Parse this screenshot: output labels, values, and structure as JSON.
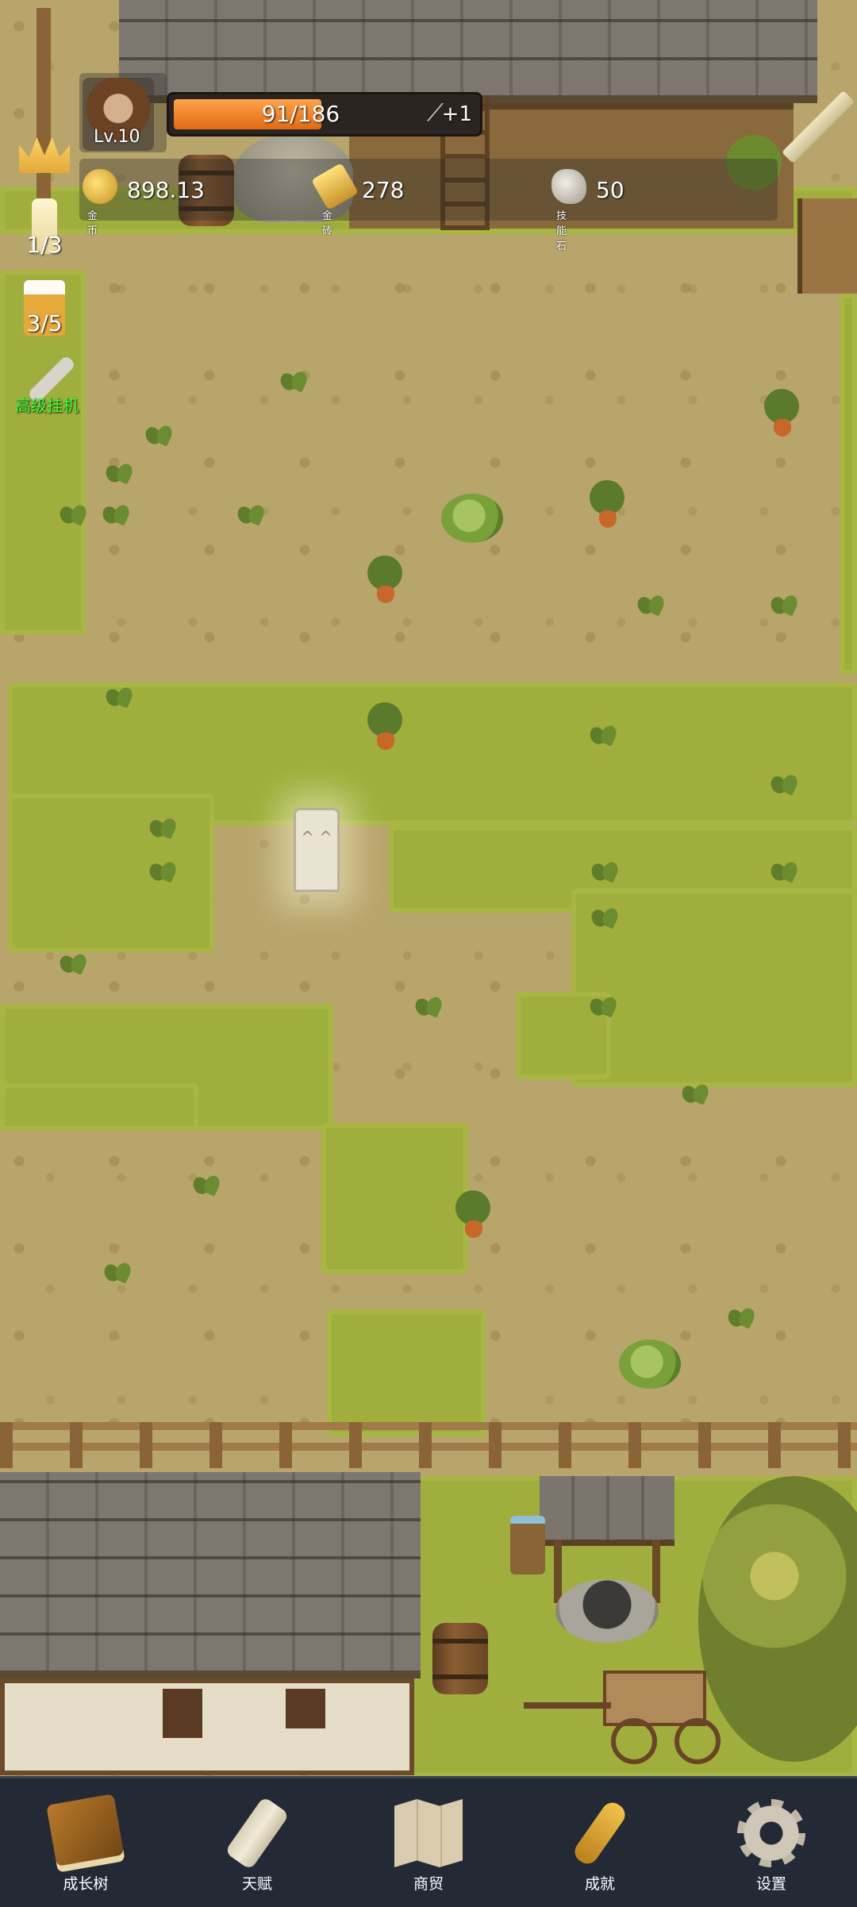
{
  "player": {
    "level_label": "Lv.10",
    "hp_text": "91/186",
    "hp_fraction": 0.489,
    "hp_regen": "+1"
  },
  "resources": [
    {
      "name": "gold-coin",
      "value": "898.13",
      "caption": "金币",
      "color": "#e2b53a"
    },
    {
      "name": "gold-brick",
      "value": "278",
      "caption": "金砖",
      "color": "#e8c24c"
    },
    {
      "name": "skill-stone",
      "value": "50",
      "caption": "技能石",
      "color": "#c9c4b6"
    }
  ],
  "side_buttons": {
    "candle_count": "1/3",
    "beer_count": "3/5",
    "auto_idle_label": "高级挂机"
  },
  "colors": {
    "hp_fill": "#f08a2c",
    "auto_idle_text": "#3cff3c",
    "nav_bg": "#232a36"
  },
  "nav": [
    {
      "label": "成长树",
      "icon": "book-icon"
    },
    {
      "label": "天赋",
      "icon": "scroll-icon"
    },
    {
      "label": "商贸",
      "icon": "map-icon"
    },
    {
      "label": "成就",
      "icon": "key-icon"
    },
    {
      "label": "设置",
      "icon": "gear-icon"
    }
  ]
}
